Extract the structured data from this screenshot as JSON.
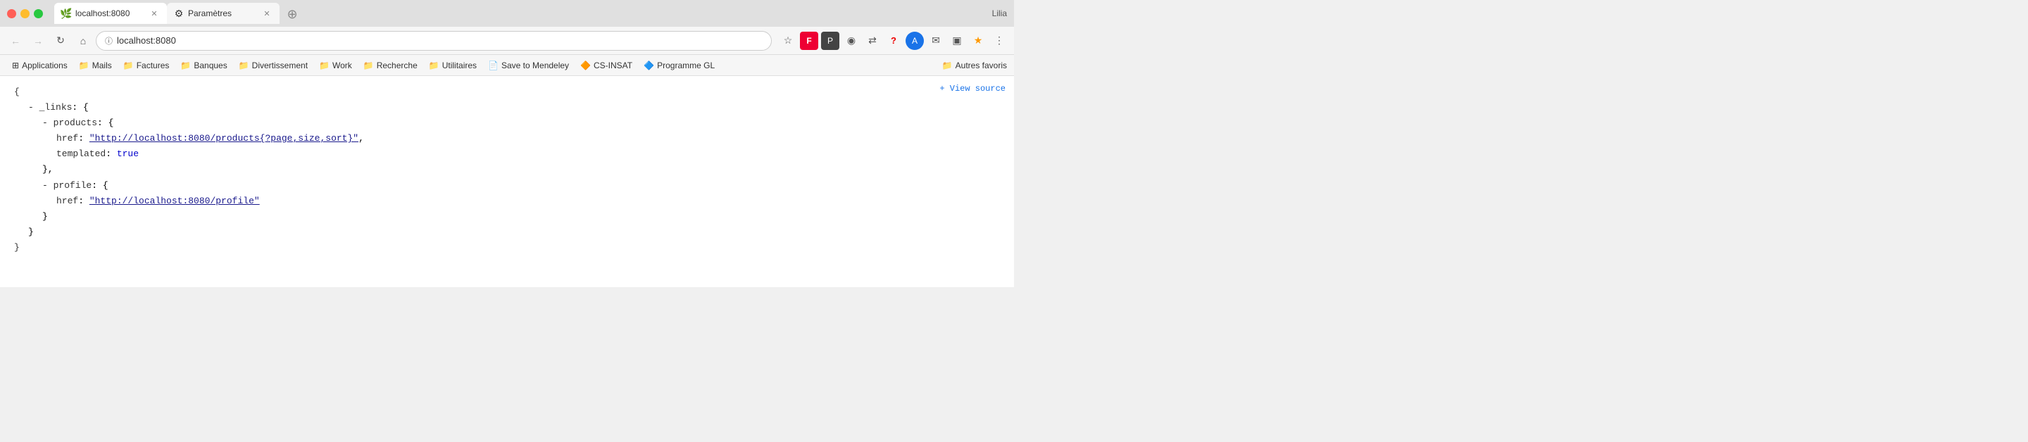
{
  "titleBar": {
    "user": "Lilia",
    "tabs": [
      {
        "id": "tab1",
        "favicon": "🌿",
        "title": "localhost:8080",
        "active": true
      },
      {
        "id": "tab2",
        "favicon": "⚙",
        "title": "Paramètres",
        "active": false
      }
    ],
    "newTabLabel": "+"
  },
  "navBar": {
    "backBtn": "←",
    "forwardBtn": "→",
    "reloadBtn": "↻",
    "homeBtn": "⌂",
    "addressUrl": "localhost:8080",
    "starIcon": "☆",
    "icons": [
      "F",
      "P",
      "◎",
      "↔",
      "?",
      "A",
      "✉",
      "▣",
      "★",
      "⋮"
    ]
  },
  "bookmarksBar": {
    "items": [
      {
        "icon": "⊞",
        "label": "Applications"
      },
      {
        "icon": "📁",
        "label": "Mails"
      },
      {
        "icon": "📁",
        "label": "Factures"
      },
      {
        "icon": "📁",
        "label": "Banques"
      },
      {
        "icon": "📁",
        "label": "Divertissement"
      },
      {
        "icon": "📁",
        "label": "Work"
      },
      {
        "icon": "📁",
        "label": "Recherche"
      },
      {
        "icon": "📁",
        "label": "Utilitaires"
      },
      {
        "icon": "📄",
        "label": "Save to Mendeley"
      },
      {
        "icon": "🔶",
        "label": "CS-INSAT"
      },
      {
        "icon": "🔷",
        "label": "Programme GL"
      }
    ],
    "autresFavoris": "Autres favoris"
  },
  "viewSourceLink": "+ View source",
  "content": {
    "lines": [
      {
        "indent": 0,
        "text": "{"
      },
      {
        "indent": 1,
        "prefix": "- ",
        "key": "_links",
        "suffix": ": {"
      },
      {
        "indent": 2,
        "prefix": "- ",
        "key": "products",
        "suffix": ": {"
      },
      {
        "indent": 3,
        "key": "href",
        "suffix": ": ",
        "value": "\"http://localhost:8080/products{?page,size,sort}\"",
        "link": true,
        "comma": ","
      },
      {
        "indent": 3,
        "key": "templated",
        "suffix": ": ",
        "value": "true",
        "bool": true
      },
      {
        "indent": 2,
        "text": "},"
      },
      {
        "indent": 2,
        "prefix": "- ",
        "key": "profile",
        "suffix": ": {"
      },
      {
        "indent": 3,
        "key": "href",
        "suffix": ": ",
        "value": "\"http://localhost:8080/profile\"",
        "link": true
      },
      {
        "indent": 2,
        "text": "}"
      },
      {
        "indent": 1,
        "text": "}"
      },
      {
        "indent": 0,
        "text": "}"
      }
    ],
    "hrefs": {
      "products": "http://localhost:8080/products{?page,size,sort}",
      "profile": "http://localhost:8080/profile"
    }
  }
}
